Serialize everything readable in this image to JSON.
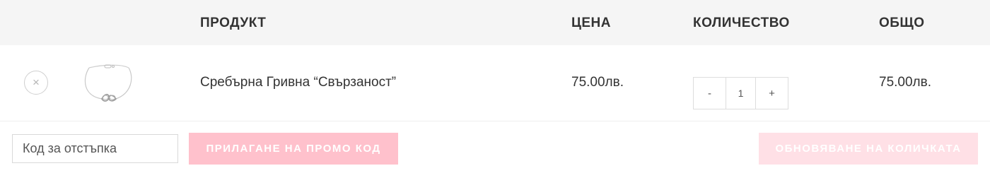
{
  "header": {
    "product": "ПРОДУКТ",
    "price": "ЦЕНА",
    "quantity": "КОЛИЧЕСТВО",
    "total": "ОБЩО"
  },
  "cart_items": [
    {
      "remove_symbol": "×",
      "thumbnail_icon": "silver-bracelet-infinity-image",
      "name": "Сребърна Гривна “Свързаност”",
      "price": "75.00лв.",
      "quantity": "1",
      "minus_label": "-",
      "plus_label": "+",
      "subtotal": "75.00лв."
    }
  ],
  "actions": {
    "coupon_placeholder": "Код за отстъпка",
    "apply_coupon_label": "ПРИЛАГАНЕ НА ПРОМО КОД",
    "update_cart_label": "ОБНОВЯВАНЕ НА КОЛИЧКАТА"
  },
  "colors": {
    "header_bg": "#f5f5f5",
    "apply_button_bg": "#ffc1cc",
    "update_button_bg": "#ffe0e6"
  }
}
